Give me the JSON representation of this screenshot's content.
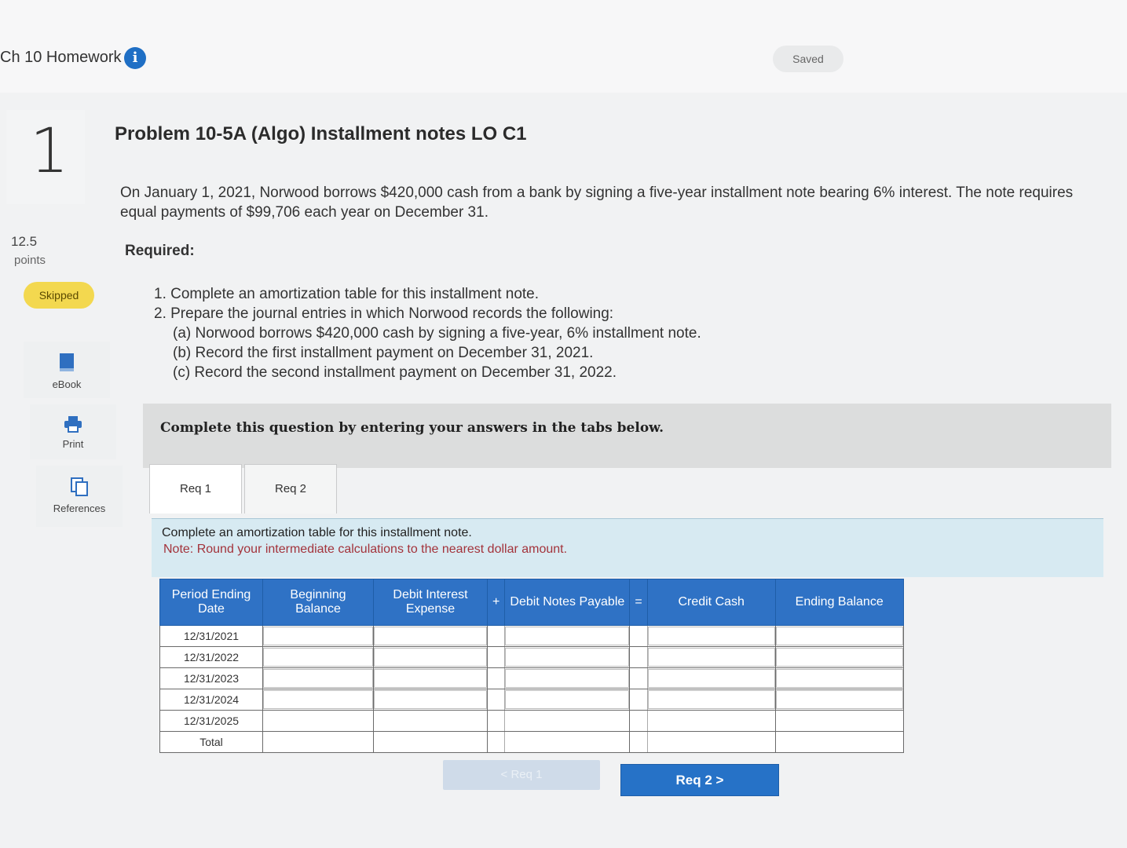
{
  "header": {
    "assignment_title": "Ch 10 Homework",
    "saved_label": "Saved"
  },
  "question": {
    "number": "1",
    "points_value": "12.5",
    "points_label": "points",
    "status": "Skipped"
  },
  "sidebar_tools": [
    {
      "label": "eBook"
    },
    {
      "label": "Print"
    },
    {
      "label": "References"
    }
  ],
  "problem": {
    "title": "Problem 10-5A (Algo) Installment notes LO C1",
    "description": "On January 1, 2021, Norwood borrows $420,000 cash from a bank by signing a five-year installment note bearing 6% interest. The note requires equal payments of $99,706 each year on December 31.",
    "required_label": "Required:",
    "requirements": [
      "1. Complete an amortization table for this installment note.",
      "2. Prepare the journal entries in which Norwood records the following:",
      "(a) Norwood borrows $420,000 cash by signing a five-year, 6% installment note.",
      "(b) Record the first installment payment on December 31, 2021.",
      "(c) Record the second installment payment on December 31, 2022."
    ]
  },
  "instruction_bar": "Complete this question by entering your answers in the tabs below.",
  "tabs": [
    {
      "label": "Req 1"
    },
    {
      "label": "Req 2"
    }
  ],
  "req1": {
    "instruction": "Complete an amortization table for this installment note.",
    "note": "Note: Round your intermediate calculations to the nearest dollar amount."
  },
  "table": {
    "headers": {
      "period": "Period Ending Date",
      "beginning": "Beginning Balance",
      "interest": "Debit Interest Expense",
      "plus": "+",
      "notes": "Debit Notes Payable",
      "equals": "=",
      "cash": "Credit Cash",
      "ending": "Ending Balance"
    },
    "rows": [
      {
        "date": "12/31/2021"
      },
      {
        "date": "12/31/2022"
      },
      {
        "date": "12/31/2023"
      },
      {
        "date": "12/31/2024"
      },
      {
        "date": "12/31/2025"
      }
    ],
    "total_label": "Total"
  },
  "nav": {
    "prev_label": "< Req 1",
    "next_label": "Req 2  >"
  }
}
